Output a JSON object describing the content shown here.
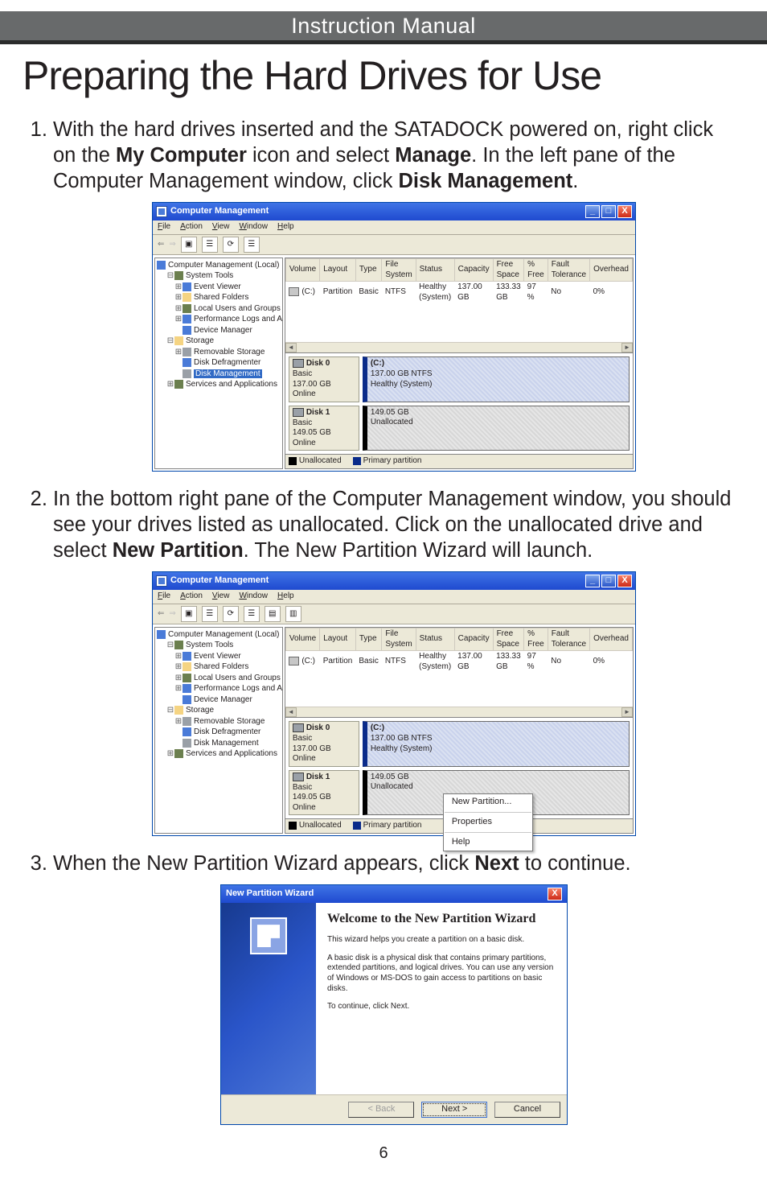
{
  "header_label": "Instruction Manual",
  "page_title": "Preparing the Hard Drives for Use",
  "steps": {
    "s1": {
      "pre": "With the hard drives inserted and the SATADOCK powered on, right click on the ",
      "b1": "My Computer",
      "mid1": " icon and select ",
      "b2": "Manage",
      "mid2": ". In the left pane of the Computer Management window, click ",
      "b3": "Disk Management",
      "post": "."
    },
    "s2": {
      "pre": "In the bottom right pane of the Computer Management window, you should see your drives listed as unallocated. Click on the unallocated drive and select ",
      "b1": "New Partition",
      "post": ". The New Partition Wizard will launch."
    },
    "s3": {
      "pre": "When the New Partition Wizard appears, click ",
      "b1": "Next",
      "post": " to continue."
    }
  },
  "cm_window": {
    "title": "Computer Management",
    "close_x": "X",
    "menubar": [
      "File",
      "Action",
      "View",
      "Window",
      "Help"
    ],
    "tree": {
      "root": "Computer Management (Local)",
      "system_tools": "System Tools",
      "event_viewer": "Event Viewer",
      "shared_folders": "Shared Folders",
      "local_users": "Local Users and Groups",
      "perf_logs": "Performance Logs and Alerts",
      "dev_mgr": "Device Manager",
      "storage": "Storage",
      "remov": "Removable Storage",
      "defrag": "Disk Defragmenter",
      "diskmgmt": "Disk Management",
      "services": "Services and Applications"
    },
    "vol_headers": [
      "Volume",
      "Layout",
      "Type",
      "File System",
      "Status",
      "Capacity",
      "Free Space",
      "% Free",
      "Fault Tolerance",
      "Overhead"
    ],
    "vol_row": {
      "volume": "(C:)",
      "layout": "Partition",
      "type": "Basic",
      "fs": "NTFS",
      "status": "Healthy (System)",
      "capacity": "137.00 GB",
      "free": "133.33 GB",
      "pct": "97 %",
      "fault": "No",
      "over": "0%"
    },
    "disk0": {
      "name": "Disk 0",
      "ptype": "Basic",
      "size": "137.00 GB",
      "state": "Online",
      "part_letter": "(C:)",
      "part_size": "137.00 GB NTFS",
      "part_status": "Healthy (System)"
    },
    "disk1": {
      "name": "Disk 1",
      "ptype": "Basic",
      "size": "149.05 GB",
      "state": "Online",
      "part_size": "149.05 GB",
      "part_status": "Unallocated"
    },
    "legend_unalloc": "Unallocated",
    "legend_primary": "Primary partition",
    "ctx_menu": {
      "new_partition": "New Partition...",
      "properties": "Properties",
      "help": "Help"
    }
  },
  "wizard": {
    "title": "New Partition Wizard",
    "heading": "Welcome to the New Partition Wizard",
    "p1": "This wizard helps you create a partition on a basic disk.",
    "p2": "A basic disk is a physical disk that contains primary partitions, extended partitions, and logical drives. You can use any version of Windows or MS-DOS to gain access to partitions on basic disks.",
    "p3": "To continue, click Next.",
    "btn_back": "< Back",
    "btn_next": "Next >",
    "btn_cancel": "Cancel"
  },
  "page_number": "6"
}
